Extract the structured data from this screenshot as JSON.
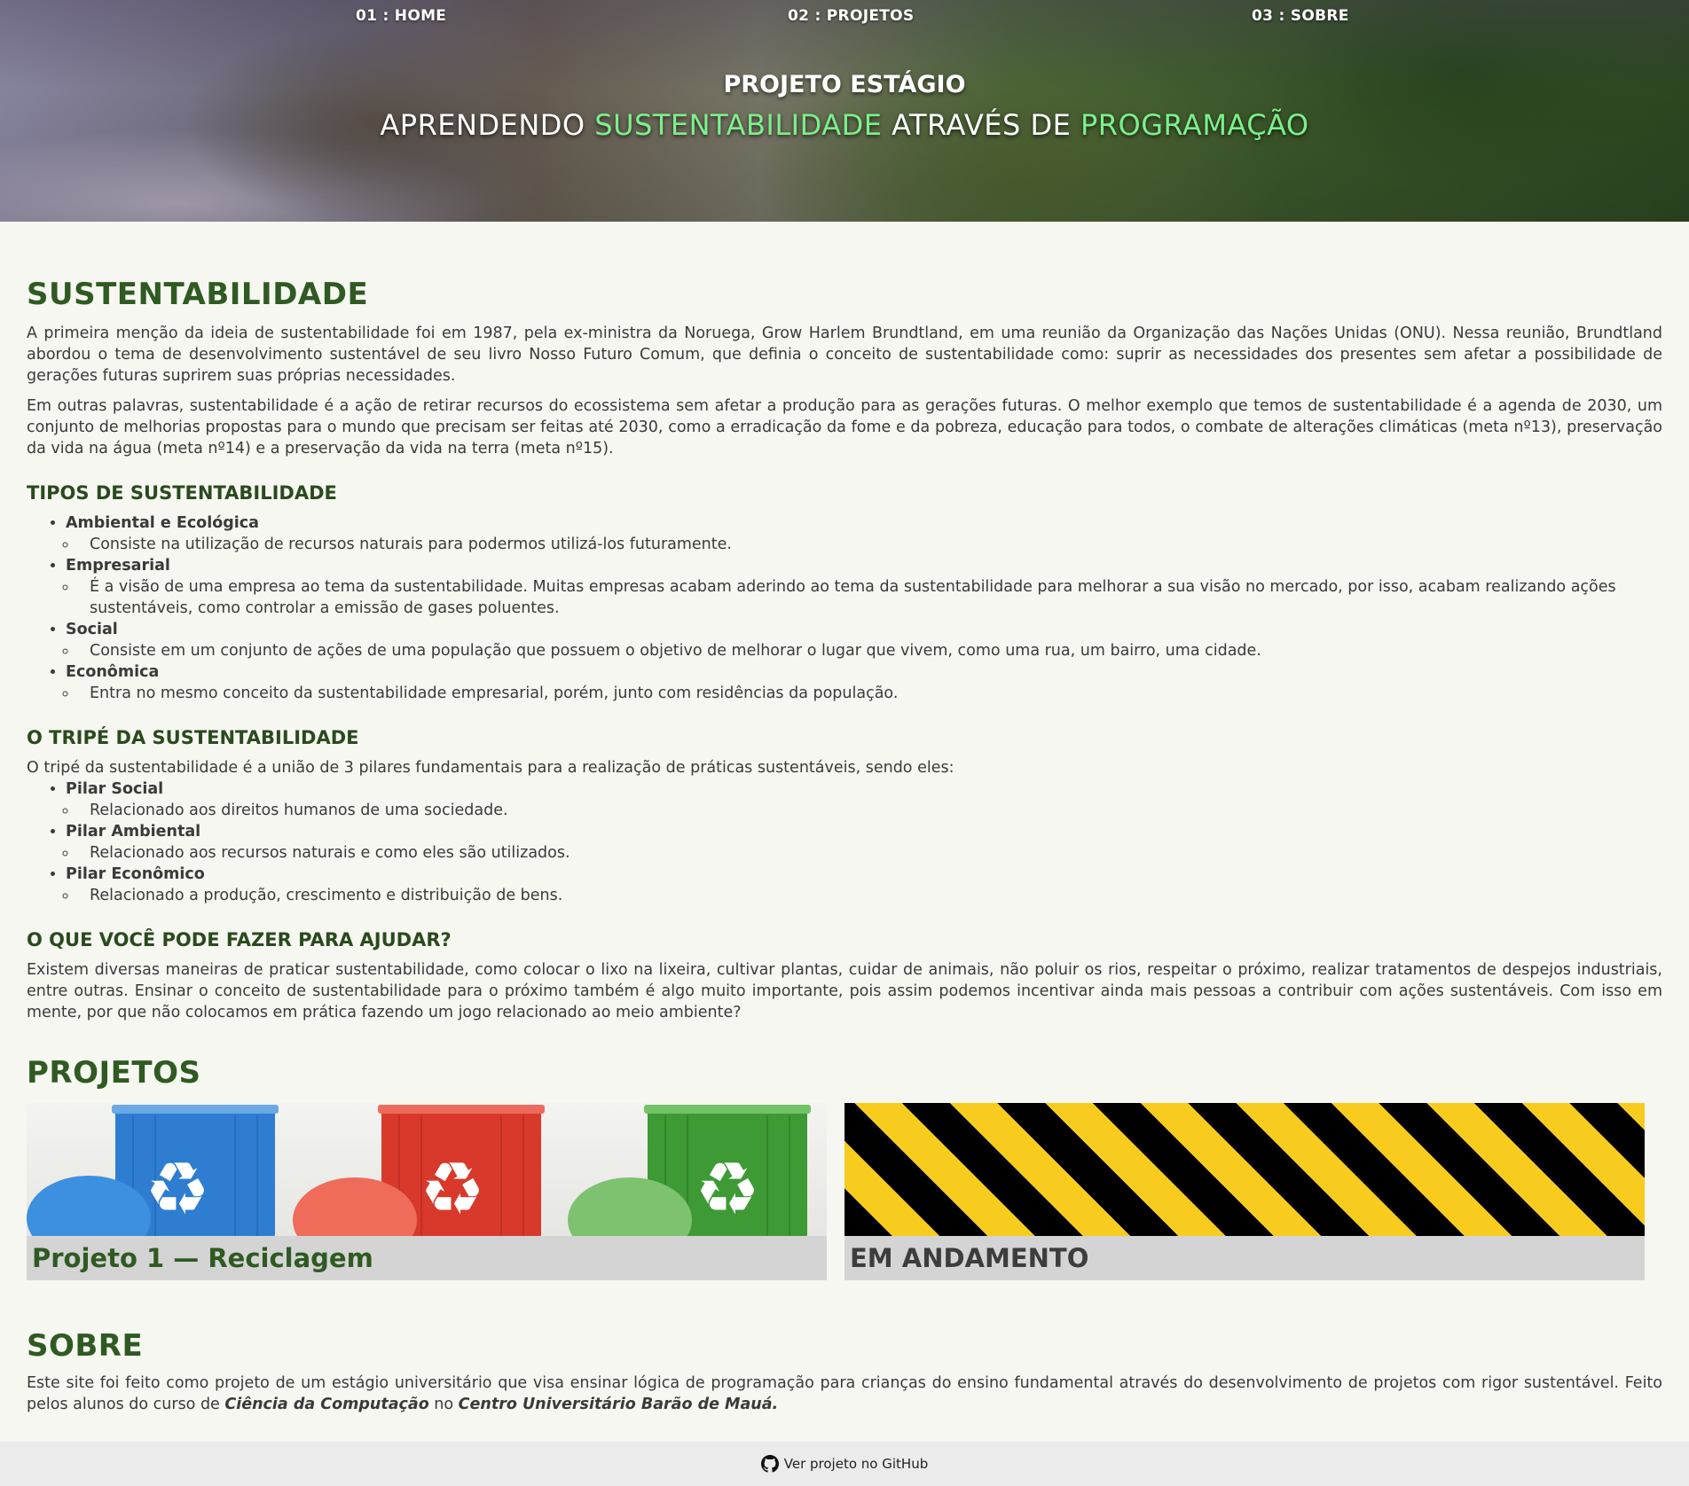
{
  "nav": {
    "home": "01 : HOME",
    "projetos": "02 : PROJETOS",
    "sobre": "03 : SOBRE"
  },
  "hero": {
    "subtitle": "PROJETO ESTÁGIO",
    "title_part1": "APRENDENDO ",
    "title_highlight1": "SUSTENTABILIDADE",
    "title_part2": " ATRAVÉS DE ",
    "title_highlight2": "PROGRAMAÇÃO",
    "highlight_color": "#7cf08b"
  },
  "sustentabilidade": {
    "heading": "SUSTENTABILIDADE",
    "paragraph1": "A primeira menção da ideia de sustentabilidade foi em 1987, pela ex-ministra da Noruega, Grow Harlem Brundtland, em uma reunião da Organização das Nações Unidas (ONU). Nessa reunião, Brundtland abordou o tema de desenvolvimento sustentável de seu livro Nosso Futuro Comum, que definia o conceito de sustentabilidade como: suprir as necessidades dos presentes sem afetar a possibilidade de gerações futuras suprirem suas próprias necessidades.",
    "paragraph2": "Em outras palavras, sustentabilidade é a ação de retirar recursos do ecossistema sem afetar a produção para as gerações futuras. O melhor exemplo que temos de sustentabilidade é a agenda de 2030, um conjunto de melhorias propostas para o mundo que precisam ser feitas até 2030, como a erradicação da fome e da pobreza, educação para todos, o combate de alterações climáticas (meta nº13), preservação da vida na água (meta nº14) e a preservação da vida na terra (meta nº15).",
    "tipos": {
      "heading": "TIPOS DE SUSTENTABILIDADE",
      "items": [
        {
          "title": "Ambiental e Ecológica",
          "desc": "Consiste na utilização de recursos naturais para podermos utilizá-los futuramente."
        },
        {
          "title": "Empresarial",
          "desc": "É a visão de uma empresa ao tema da sustentabilidade. Muitas empresas acabam aderindo ao tema da sustentabilidade para melhorar a sua visão no mercado, por isso, acabam realizando ações sustentáveis, como controlar a emissão de gases poluentes."
        },
        {
          "title": "Social",
          "desc": "Consiste em um conjunto de ações de uma população que possuem o objetivo de melhorar o lugar que vivem, como uma rua, um bairro, uma cidade."
        },
        {
          "title": "Econômica",
          "desc": "Entra no mesmo conceito da sustentabilidade empresarial, porém, junto com residências da população."
        }
      ]
    },
    "tripe": {
      "heading": "O TRIPÉ DA SUSTENTABILIDADE",
      "intro": "O tripé da sustentabilidade é a união de 3 pilares fundamentais para a realização de práticas sustentáveis, sendo eles:",
      "items": [
        {
          "title": "Pilar Social",
          "desc": "Relacionado aos direitos humanos de uma sociedade."
        },
        {
          "title": "Pilar Ambiental",
          "desc": "Relacionado aos recursos naturais e como eles são utilizados."
        },
        {
          "title": "Pilar Econômico",
          "desc": "Relacionado a produção, crescimento e distribuição de bens."
        }
      ]
    },
    "ajudar": {
      "heading": "O QUE VOCÊ PODE FAZER PARA AJUDAR?",
      "paragraph": "Existem diversas maneiras de praticar sustentabilidade, como colocar o lixo na lixeira, cultivar plantas, cuidar de animais, não poluir os rios, respeitar o próximo, realizar tratamentos de despejos industriais, entre outras. Ensinar o conceito de sustentabilidade para o próximo também é algo muito importante, pois assim podemos incentivar ainda mais pessoas a contribuir com ações sustentáveis. Com isso em mente, por que não colocamos em prática fazendo um jogo relacionado ao meio ambiente?"
    }
  },
  "projetos": {
    "heading": "PROJETOS",
    "cards": [
      {
        "label": "Projeto 1 — Reciclagem",
        "label_color": "#2f5a22"
      },
      {
        "label": "EM ANDAMENTO",
        "label_color": "#3d3d3d"
      }
    ]
  },
  "sobre": {
    "heading": "SOBRE",
    "text_before": "Este site foi feito como projeto de um estágio universitário que visa ensinar lógica de programação para crianças do ensino fundamental através do desenvolvimento de projetos com rigor sustentável. Feito pelos alunos do curso de ",
    "course": "Ciência da Computação",
    "text_middle": " no ",
    "institution": "Centro Universitário Barão de Mauá."
  },
  "footer": {
    "github_icon": "github-icon",
    "github_link": "Ver projeto no GitHub"
  },
  "colors": {
    "page_bg": "#f6f7f1",
    "section_heading": "#2f5a22",
    "footer_bg": "#ebebeb",
    "card_bg": "#d4d4d4"
  }
}
